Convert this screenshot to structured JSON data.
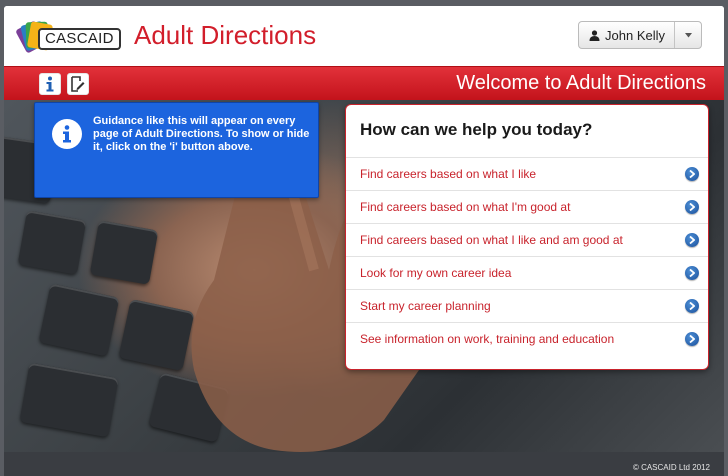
{
  "header": {
    "logo_text": "CASCAID",
    "app_title": "Adult Directions",
    "user": {
      "name": "John Kelly",
      "icon": "user-icon",
      "caret_icon": "caret-down-icon"
    }
  },
  "toolbar": {
    "info_icon": "info-icon",
    "notes_icon": "edit-note-icon",
    "welcome": "Welcome to Adult Directions",
    "accent_color": "#d21e2b"
  },
  "guidance": {
    "icon": "info-circle-icon",
    "text": "Guidance like this will appear on every page of Adult Directions. To show or hide it, click on the 'i' button above.",
    "color": "#1c64de"
  },
  "help_panel": {
    "title": "How can we help you today?",
    "options": [
      {
        "label": "Find careers based on what I like"
      },
      {
        "label": "Find careers based on what I'm good at"
      },
      {
        "label": "Find careers based on what I like and am good at"
      },
      {
        "label": "Look for my own career idea"
      },
      {
        "label": "Start my career planning"
      },
      {
        "label": "See information on work, training and education"
      }
    ],
    "option_icon": "chevron-right-circle-icon"
  },
  "footer": {
    "copyright": "© CASCAID Ltd 2012"
  }
}
